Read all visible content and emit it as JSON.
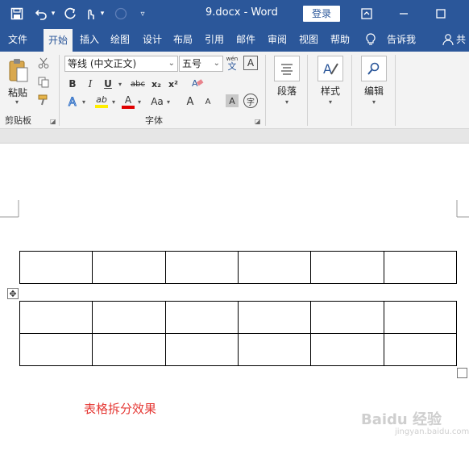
{
  "window": {
    "doc_title": "9.docx  -  Word",
    "login_label": "登录"
  },
  "tabs": [
    {
      "label": "文件"
    },
    {
      "label": "开始"
    },
    {
      "label": "插入"
    },
    {
      "label": "绘图"
    },
    {
      "label": "设计"
    },
    {
      "label": "布局"
    },
    {
      "label": "引用"
    },
    {
      "label": "邮件"
    },
    {
      "label": "审阅"
    },
    {
      "label": "视图"
    },
    {
      "label": "帮助"
    },
    {
      "label": "告诉我"
    },
    {
      "label": "共"
    }
  ],
  "ribbon": {
    "clipboard": {
      "paste_label": "粘贴",
      "group_label": "剪贴板"
    },
    "font": {
      "font_name": "等线 (中文正文)",
      "font_size": "五号",
      "group_label": "字体",
      "wen_glyph": "wén",
      "wen_char": "文",
      "bold": "B",
      "italic": "I",
      "underline": "U",
      "strike": "abc",
      "subscript": "x₂",
      "superscript": "x²",
      "highlight": "ab",
      "font_color": "A",
      "change_case": "Aa",
      "grow": "A",
      "shrink": "A",
      "char_shading": "A",
      "enclose": "字"
    },
    "paragraph": {
      "label": "段落"
    },
    "styles": {
      "label": "样式"
    },
    "editing": {
      "label": "编辑"
    }
  },
  "document": {
    "caption": "表格拆分效果",
    "table_top": {
      "rows": 1,
      "cols": 6
    },
    "table_bottom": {
      "rows": 2,
      "cols": 6
    }
  },
  "watermark": {
    "text": "Baidu 经验",
    "url": "jingyan.baidu.com"
  },
  "colors": {
    "title_bar": "#2b579a",
    "ribbon_bg": "#f3f3f3",
    "caption": "#e53935"
  }
}
